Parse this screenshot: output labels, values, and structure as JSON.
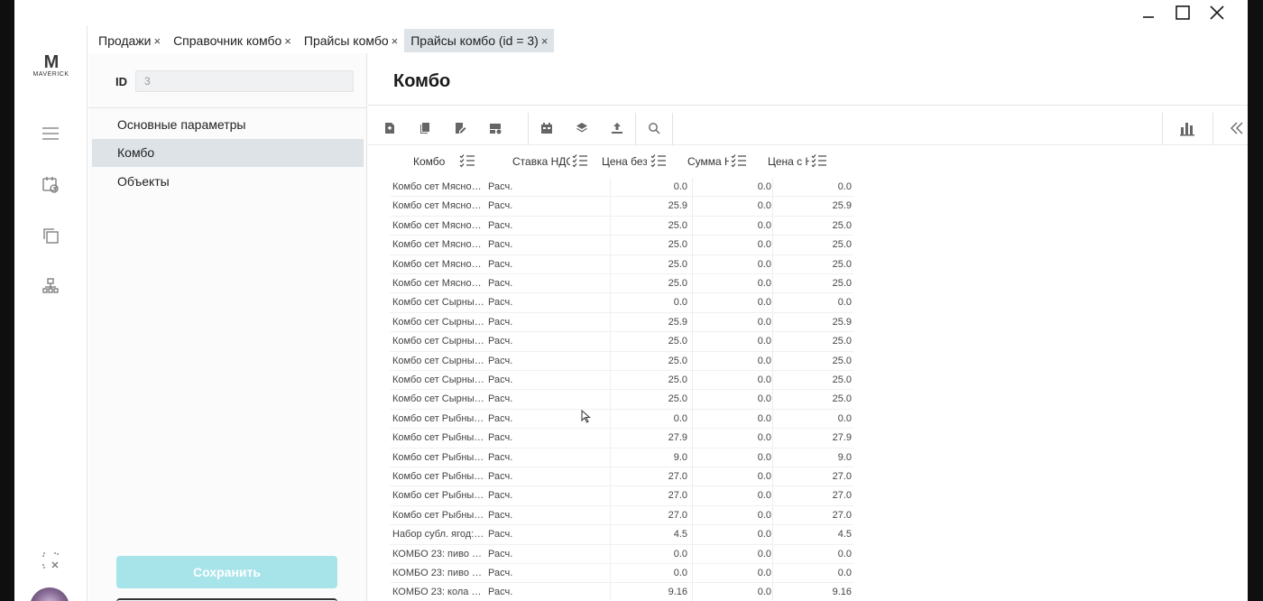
{
  "window_controls": [
    "minimize",
    "maximize",
    "close"
  ],
  "logo": {
    "mark": "M",
    "text": "MAVERICK"
  },
  "rail": {
    "icons": [
      "menu-icon",
      "calendar-clock-icon",
      "copy-icon",
      "org-structure-icon",
      "selection-close-icon"
    ]
  },
  "tabs": [
    {
      "label": "Продажи",
      "close": "×"
    },
    {
      "label": "Справочник комбо",
      "close": "×"
    },
    {
      "label": "Прайсы комбо",
      "close": "×"
    },
    {
      "label": "Прайсы комбо (id = 3)",
      "close": "×",
      "active": true
    }
  ],
  "form": {
    "id_label": "ID",
    "id_value": "3",
    "nav": [
      "Основные параметры",
      "Комбо",
      "Объекты"
    ],
    "active_nav": "Комбо",
    "save_label": "Сохранить"
  },
  "main": {
    "title": "Комбо",
    "toolbar_icons": [
      "add-doc-icon",
      "copy-doc-icon",
      "edit-doc-icon",
      "view-doc-icon",
      "calendar-icon",
      "layers-icon",
      "upload-icon",
      "search-icon",
      "chart-icon",
      "collapse-left-icon"
    ]
  },
  "table": {
    "columns": [
      "Комбо",
      "Ставка НДС",
      "Цена без",
      "Сумма Н",
      "Цена с Н"
    ],
    "rows": [
      [
        "Комбо сет Мясной…",
        "Расч.",
        "0.0",
        "0.0",
        "0.0"
      ],
      [
        "Комбо сет Мясной…",
        "Расч.",
        "25.9",
        "0.0",
        "25.9"
      ],
      [
        "Комбо сет Мясной…",
        "Расч.",
        "25.0",
        "0.0",
        "25.0"
      ],
      [
        "Комбо сет Мясной…",
        "Расч.",
        "25.0",
        "0.0",
        "25.0"
      ],
      [
        "Комбо сет Мясной…",
        "Расч.",
        "25.0",
        "0.0",
        "25.0"
      ],
      [
        "Комбо сет Мясной…",
        "Расч.",
        "25.0",
        "0.0",
        "25.0"
      ],
      [
        "Комбо сет Сырны…",
        "Расч.",
        "0.0",
        "0.0",
        "0.0"
      ],
      [
        "Комбо сет Сырны…",
        "Расч.",
        "25.9",
        "0.0",
        "25.9"
      ],
      [
        "Комбо сет Сырны…",
        "Расч.",
        "25.0",
        "0.0",
        "25.0"
      ],
      [
        "Комбо сет Сырны…",
        "Расч.",
        "25.0",
        "0.0",
        "25.0"
      ],
      [
        "Комбо сет Сырны…",
        "Расч.",
        "25.0",
        "0.0",
        "25.0"
      ],
      [
        "Комбо сет Сырны…",
        "Расч.",
        "25.0",
        "0.0",
        "25.0"
      ],
      [
        "Комбо сет Рыбны…",
        "Расч.",
        "0.0",
        "0.0",
        "0.0"
      ],
      [
        "Комбо сет Рыбны…",
        "Расч.",
        "27.9",
        "0.0",
        "27.9"
      ],
      [
        "Комбо сет Рыбны…",
        "Расч.",
        "9.0",
        "0.0",
        "9.0"
      ],
      [
        "Комбо сет Рыбны…",
        "Расч.",
        "27.0",
        "0.0",
        "27.0"
      ],
      [
        "Комбо сет Рыбны…",
        "Расч.",
        "27.0",
        "0.0",
        "27.0"
      ],
      [
        "Комбо сет Рыбны…",
        "Расч.",
        "27.0",
        "0.0",
        "27.0"
      ],
      [
        "Набор субл. ягод: …",
        "Расч.",
        "4.5",
        "0.0",
        "4.5"
      ],
      [
        "КОМБО 23: пиво …",
        "Расч.",
        "0.0",
        "0.0",
        "0.0"
      ],
      [
        "КОМБО 23: пиво …",
        "Расч.",
        "0.0",
        "0.0",
        "0.0"
      ],
      [
        "КОМБО 23: кола 0…",
        "Расч.",
        "9.16",
        "0.0",
        "9.16"
      ]
    ]
  }
}
